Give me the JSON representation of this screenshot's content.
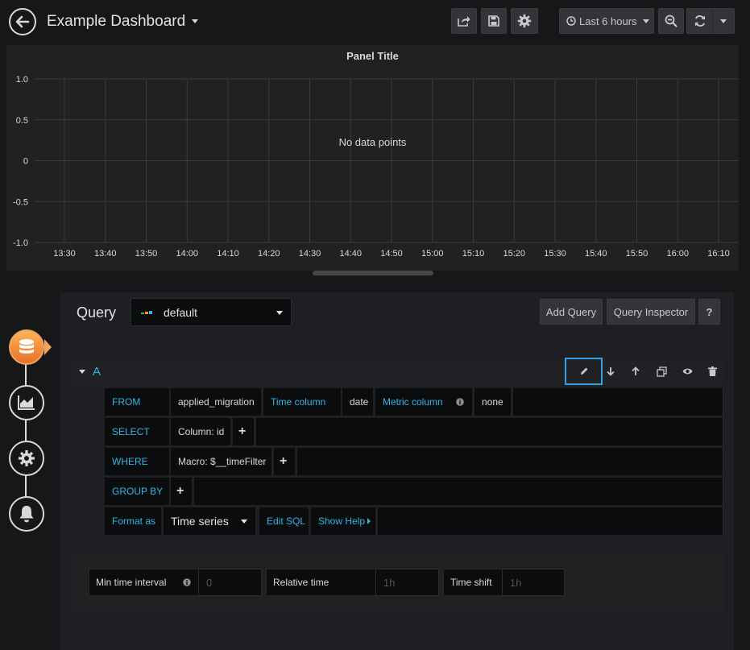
{
  "navbar": {
    "title": "Example Dashboard",
    "time_range": "Last 6 hours"
  },
  "panel": {
    "title": "Panel Title",
    "empty_message": "No data points",
    "y_ticks": [
      "1.0",
      "0.5",
      "0",
      "-0.5",
      "-1.0"
    ],
    "x_ticks": [
      "13:30",
      "13:40",
      "13:50",
      "14:00",
      "14:10",
      "14:20",
      "14:30",
      "14:40",
      "14:50",
      "15:00",
      "15:10",
      "15:20",
      "15:30",
      "15:40",
      "15:50",
      "16:00",
      "16:10"
    ]
  },
  "editor": {
    "query_label": "Query",
    "datasource": "default",
    "add_query": "Add Query",
    "query_inspector": "Query Inspector",
    "help": "?",
    "query_ref": "A",
    "from_kw": "FROM",
    "from_table": "applied_migration",
    "time_column_kw": "Time column",
    "time_column_value": "date",
    "metric_column_kw": "Metric column",
    "metric_column_value": "none",
    "select_kw": "SELECT",
    "select_value": "Column: id",
    "where_kw": "WHERE",
    "where_value": "Macro: $__timeFilter",
    "group_by_kw": "GROUP BY",
    "format_as_kw": "Format as",
    "format_as_value": "Time series",
    "edit_sql": "Edit SQL",
    "show_help": "Show Help",
    "plus": "+"
  },
  "options": {
    "min_interval_label": "Min time interval",
    "min_interval_placeholder": "0",
    "relative_time_label": "Relative time",
    "relative_time_placeholder": "1h",
    "time_shift_label": "Time shift",
    "time_shift_placeholder": "1h"
  },
  "colors": {
    "accent_blue": "#33b5e5",
    "active_orange": "#f0a35a"
  },
  "icons": {
    "rail": [
      "database-icon",
      "chart-icon",
      "settings-icon",
      "bell-icon"
    ]
  }
}
